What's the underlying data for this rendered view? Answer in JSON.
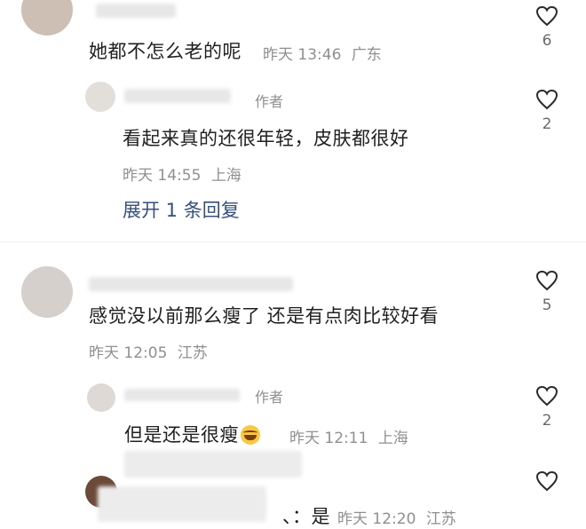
{
  "comments": [
    {
      "text": "她都不怎么老的呢",
      "time": "昨天 13:46",
      "location": "广东",
      "likes": "6"
    },
    {
      "author_tag": "作者",
      "text": "看起来真的还很年轻，皮肤都很好",
      "time": "昨天 14:55",
      "location": "上海",
      "likes": "2",
      "expand_label": "展开 1 条回复"
    },
    {
      "text": "感觉没以前那么瘦了 还是有点肉比较好看",
      "time": "昨天 12:05",
      "location": "江苏",
      "likes": "5"
    },
    {
      "author_tag": "作者",
      "text": "但是还是很瘦",
      "emoji": "laughing-tears-emoji",
      "time": "昨天 12:11",
      "location": "上海",
      "likes": "2"
    },
    {
      "text": "、：是",
      "time": "昨天 12:20",
      "location": "江苏"
    }
  ],
  "icons": {
    "like": "heart-outline-icon"
  },
  "colors": {
    "text": "#1f1f1f",
    "meta": "#8f8f8f",
    "expand_link": "#36507a"
  }
}
